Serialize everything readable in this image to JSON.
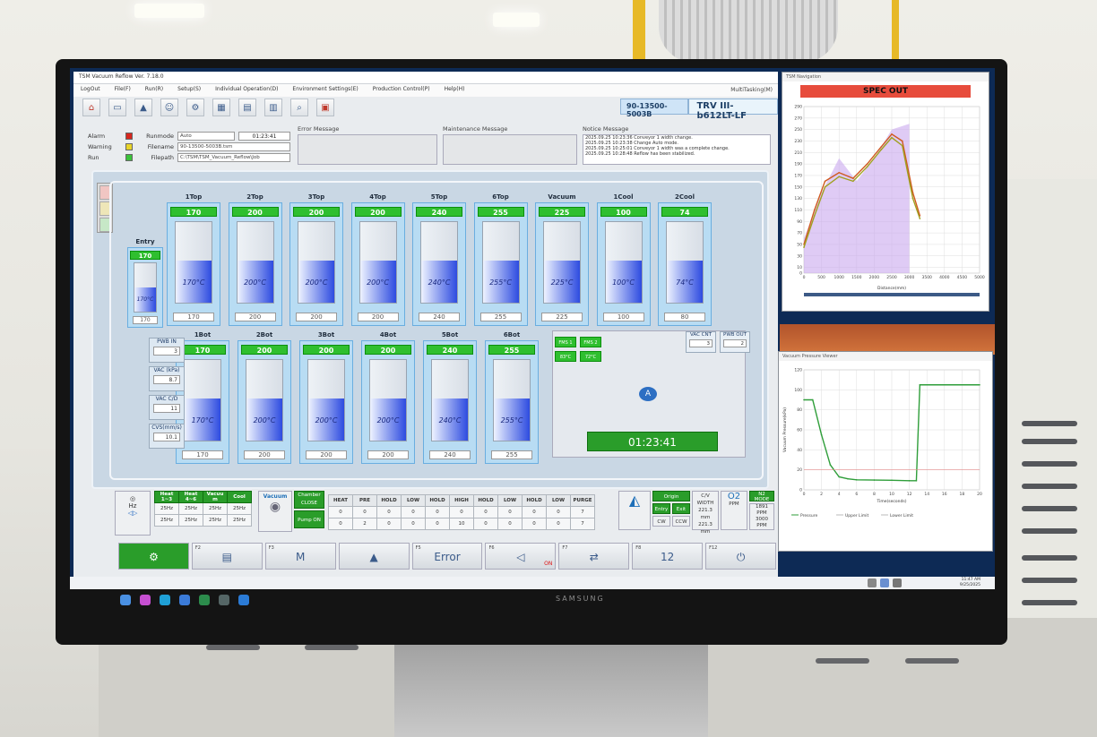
{
  "app": {
    "title": "TSM Vacuum Reflow Ver. 7.18.0",
    "menu": [
      "LogOut",
      "File(F)",
      "Run(R)",
      "Setup(S)",
      "Individual Operation(D)",
      "Environment Settings(E)",
      "Production Control(P)",
      "Help(H)"
    ],
    "multitasking": "MultiTasking(M)",
    "program_id": "90-13500-5003B",
    "model": "TRV III-b612LT-LF"
  },
  "status": {
    "alarm": "Alarm",
    "warning": "Warning",
    "run": "Run",
    "runmode_label": "Runmode",
    "runmode_value": "Auto",
    "elapsed": "01:23:41",
    "filename_label": "Filename",
    "filename_value": "90-13500-5003B.tsm",
    "filepath_label": "Filepath",
    "filepath_value": "C:\\TSM\\TSM_Vacuum_Reflow\\Job",
    "lamp_colors": {
      "alarm": "#d7261e",
      "warning": "#e8d42a",
      "run": "#3ac23a"
    }
  },
  "messages": {
    "error_title": "Error Message",
    "maintenance_title": "Maintenance Message",
    "notice_title": "Notice Message",
    "notices": [
      "2025.09.25 10:23:36 Conveyor 1 width change.",
      "2025.09.25 10:23:38 Change Auto mode.",
      "2025.09.25 10:25:01 Conveyor 1 width was a complete change.",
      "2025.09.25 10:28:48 Reflow has been stabilized."
    ]
  },
  "entry": {
    "label": "Entry",
    "sp": "170",
    "pv": "170°C",
    "rd": "170"
  },
  "top_zones": [
    {
      "name": "1Top",
      "sp": "170",
      "pv": "170°C",
      "rd": "170"
    },
    {
      "name": "2Top",
      "sp": "200",
      "pv": "200°C",
      "rd": "200"
    },
    {
      "name": "3Top",
      "sp": "200",
      "pv": "200°C",
      "rd": "200"
    },
    {
      "name": "4Top",
      "sp": "200",
      "pv": "200°C",
      "rd": "200"
    },
    {
      "name": "5Top",
      "sp": "240",
      "pv": "240°C",
      "rd": "240"
    },
    {
      "name": "6Top",
      "sp": "255",
      "pv": "255°C",
      "rd": "255"
    },
    {
      "name": "Vacuum",
      "sp": "225",
      "pv": "225°C",
      "rd": "225"
    },
    {
      "name": "1Cool",
      "sp": "100",
      "pv": "100°C",
      "rd": "100"
    },
    {
      "name": "2Cool",
      "sp": "74",
      "pv": "74°C",
      "rd": "80"
    }
  ],
  "bot_zones": [
    {
      "name": "1Bot",
      "sp": "170",
      "pv": "170°C",
      "rd": "170"
    },
    {
      "name": "2Bot",
      "sp": "200",
      "pv": "200°C",
      "rd": "200"
    },
    {
      "name": "3Bot",
      "sp": "200",
      "pv": "200°C",
      "rd": "200"
    },
    {
      "name": "4Bot",
      "sp": "200",
      "pv": "200°C",
      "rd": "200"
    },
    {
      "name": "5Bot",
      "sp": "240",
      "pv": "240°C",
      "rd": "240"
    },
    {
      "name": "6Bot",
      "sp": "255",
      "pv": "255°C",
      "rd": "255"
    }
  ],
  "side": [
    {
      "label": "PWB IN",
      "value": "3"
    },
    {
      "label": "VAC (kPa)",
      "value": "8.7"
    },
    {
      "label": "VAC C/D",
      "value": "11"
    },
    {
      "label": "CVS(mm/s)",
      "value": "10.1"
    }
  ],
  "vacuum_area": {
    "fms1": "FMS 1",
    "fms2": "FMS 2",
    "fms1_val": "83°C",
    "fms2_val": "72°C",
    "vac_cnt_label": "VAC CNT",
    "vac_cnt": "3",
    "pwb_out_label": "PWB OUT",
    "pwb_out": "2",
    "timer": "01:23:41"
  },
  "controls": {
    "fan_headers": [
      "Heat 1~3",
      "Heat 4~6",
      "Vacuu m",
      "Cool"
    ],
    "fan_row1": [
      "25Hz",
      "25Hz",
      "25Hz",
      "25Hz"
    ],
    "fan_row2": [
      "25Hz",
      "25Hz",
      "25Hz",
      "25Hz"
    ],
    "hz_label": "Hz",
    "vacuum_label": "Vacuum",
    "chamber_close": "Chamber CLOSE",
    "pump_on": "Pump ON",
    "seq_headers": [
      "HEAT",
      "PRE",
      "HOLD",
      "LOW",
      "HOLD",
      "HIGH",
      "HOLD",
      "LOW",
      "HOLD",
      "LOW",
      "PURGE"
    ],
    "seq_row1": [
      "0",
      "0",
      "0",
      "0",
      "0",
      "0",
      "0",
      "0",
      "0",
      "0",
      "7"
    ],
    "seq_row2": [
      "0",
      "2",
      "0",
      "0",
      "0",
      "10",
      "0",
      "0",
      "0",
      "0",
      "7"
    ],
    "origin": "Origin",
    "entry": "Entry",
    "exit": "Exit",
    "cw": "CW",
    "ccw": "CCW",
    "cv_width": "C/V WIDTH",
    "width1": "221.3",
    "width2": "221.3",
    "unit": "mm",
    "o2_label": "O2",
    "ppm": "PPM",
    "n2_mode": "N2 MODE",
    "n2_val1": "1891",
    "n2_val2": "3000"
  },
  "fkeys": [
    {
      "label": "",
      "icon": "⚙"
    },
    {
      "label": "F2",
      "icon": "▤"
    },
    {
      "label": "F3",
      "icon": "M"
    },
    {
      "label": "",
      "icon": "▲"
    },
    {
      "label": "F5",
      "icon": "Error"
    },
    {
      "label": "F6",
      "icon": "◁",
      "on": "ON"
    },
    {
      "label": "F7",
      "icon": "⇄"
    },
    {
      "label": "F8",
      "icon": "12"
    },
    {
      "label": "F12",
      "icon": "⏻"
    }
  ],
  "profile_window": {
    "title": "TSM Navigation",
    "spec_out": "SPEC OUT",
    "xlabel": "Distance(mm)"
  },
  "pressure_window": {
    "title": "Vacuum Pressure Viewer",
    "ylabel": "Vacuum Pressure(kPa)",
    "xlabel": "Time(seconds)",
    "legend": [
      "Pressure",
      "Upper Limit",
      "Lower Limit"
    ]
  },
  "chart_data": [
    {
      "type": "line",
      "title": "SPEC OUT",
      "xlabel": "Distance(mm)",
      "ylabel": "",
      "xlim": [
        0,
        5000
      ],
      "ylim": [
        0,
        290
      ],
      "x_ticks": [
        0,
        500,
        1000,
        1500,
        2000,
        2500,
        3000,
        3500,
        4000,
        4500,
        5000
      ],
      "y_ticks": [
        0,
        10,
        30,
        50,
        70,
        90,
        110,
        130,
        150,
        170,
        190,
        210,
        230,
        250,
        270,
        290
      ],
      "series": [
        {
          "color": "#d05a20",
          "x": [
            0,
            300,
            600,
            1000,
            1400,
            1800,
            2200,
            2500,
            2800,
            3100,
            3300
          ],
          "y": [
            50,
            110,
            160,
            175,
            165,
            190,
            220,
            242,
            230,
            140,
            100
          ]
        },
        {
          "color": "#a0a020",
          "x": [
            0,
            300,
            600,
            1000,
            1400,
            1800,
            2200,
            2500,
            2800,
            3100,
            3300
          ],
          "y": [
            45,
            100,
            150,
            168,
            160,
            185,
            215,
            236,
            222,
            130,
            95
          ]
        }
      ],
      "area": {
        "x": [
          0,
          500,
          1000,
          1500,
          2000,
          2500,
          3000,
          3000
        ],
        "y": [
          60,
          140,
          200,
          160,
          200,
          250,
          260,
          0
        ]
      }
    },
    {
      "type": "line",
      "title": "",
      "xlabel": "Time(seconds)",
      "ylabel": "Vacuum Pressure(kPa)",
      "xlim": [
        0,
        20
      ],
      "ylim": [
        0,
        120
      ],
      "x_ticks": [
        0,
        2,
        4,
        6,
        8,
        10,
        12,
        14,
        16,
        18,
        20
      ],
      "y_ticks": [
        0,
        20,
        40,
        60,
        80,
        100,
        120
      ],
      "series": [
        {
          "name": "Pressure",
          "color": "#2f9e3a",
          "x": [
            0,
            1,
            2,
            3,
            4,
            5,
            6,
            8,
            10,
            12,
            12.8,
            13.2,
            14,
            16,
            18,
            20
          ],
          "y": [
            90,
            90,
            55,
            25,
            13,
            11,
            10,
            9.8,
            9.6,
            9.1,
            9.1,
            105,
            105,
            105,
            105,
            105
          ]
        }
      ]
    }
  ]
}
